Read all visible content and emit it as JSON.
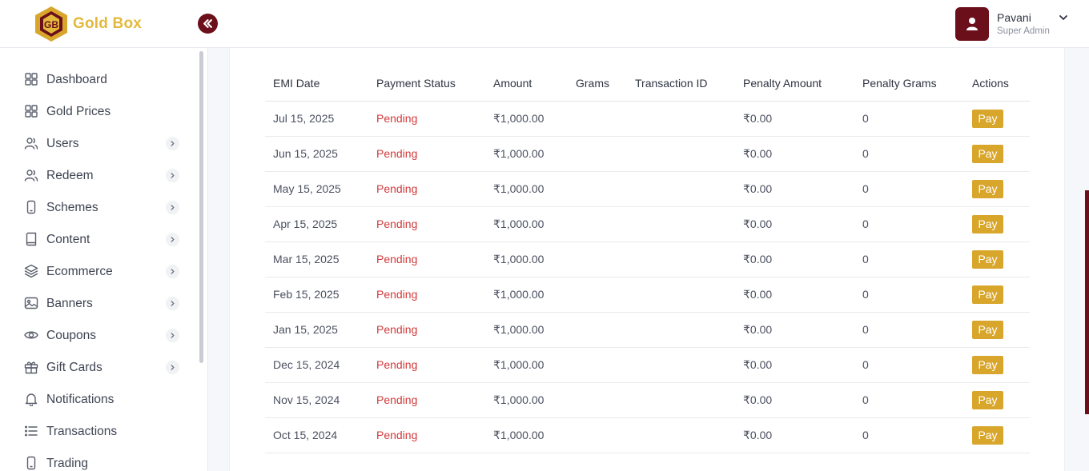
{
  "header": {
    "brand": "Gold Box",
    "user_name": "Pavani",
    "user_role": "Super Admin"
  },
  "colors": {
    "primary": "#6b0f1a",
    "accent_gold": "#d9a62c",
    "brand_text": "#e2b93b",
    "pending": "#d23a3a"
  },
  "sidebar": {
    "items": [
      {
        "label": "Dashboard",
        "icon": "grid-icon",
        "has_submenu": false
      },
      {
        "label": "Gold Prices",
        "icon": "grid-icon",
        "has_submenu": false
      },
      {
        "label": "Users",
        "icon": "users-icon",
        "has_submenu": true
      },
      {
        "label": "Redeem",
        "icon": "users-icon",
        "has_submenu": true
      },
      {
        "label": "Schemes",
        "icon": "mobile-icon",
        "has_submenu": true
      },
      {
        "label": "Content",
        "icon": "book-icon",
        "has_submenu": true
      },
      {
        "label": "Ecommerce",
        "icon": "layers-icon",
        "has_submenu": true
      },
      {
        "label": "Banners",
        "icon": "image-icon",
        "has_submenu": true
      },
      {
        "label": "Coupons",
        "icon": "eye-icon",
        "has_submenu": true
      },
      {
        "label": "Gift Cards",
        "icon": "gift-icon",
        "has_submenu": true
      },
      {
        "label": "Notifications",
        "icon": "bell-icon",
        "has_submenu": false
      },
      {
        "label": "Transactions",
        "icon": "list-icon",
        "has_submenu": false
      },
      {
        "label": "Trading",
        "icon": "mobile-icon",
        "has_submenu": false
      }
    ]
  },
  "table": {
    "headers": [
      "EMI Date",
      "Payment Status",
      "Amount",
      "Grams",
      "Transaction ID",
      "Penalty Amount",
      "Penalty Grams",
      "Actions"
    ],
    "action_label": "Pay",
    "rows": [
      {
        "date": "Jul 15, 2025",
        "status": "Pending",
        "amount": "₹1,000.00",
        "grams": "",
        "txn": "",
        "penalty_amount": "₹0.00",
        "penalty_grams": "0"
      },
      {
        "date": "Jun 15, 2025",
        "status": "Pending",
        "amount": "₹1,000.00",
        "grams": "",
        "txn": "",
        "penalty_amount": "₹0.00",
        "penalty_grams": "0"
      },
      {
        "date": "May 15, 2025",
        "status": "Pending",
        "amount": "₹1,000.00",
        "grams": "",
        "txn": "",
        "penalty_amount": "₹0.00",
        "penalty_grams": "0"
      },
      {
        "date": "Apr 15, 2025",
        "status": "Pending",
        "amount": "₹1,000.00",
        "grams": "",
        "txn": "",
        "penalty_amount": "₹0.00",
        "penalty_grams": "0"
      },
      {
        "date": "Mar 15, 2025",
        "status": "Pending",
        "amount": "₹1,000.00",
        "grams": "",
        "txn": "",
        "penalty_amount": "₹0.00",
        "penalty_grams": "0"
      },
      {
        "date": "Feb 15, 2025",
        "status": "Pending",
        "amount": "₹1,000.00",
        "grams": "",
        "txn": "",
        "penalty_amount": "₹0.00",
        "penalty_grams": "0"
      },
      {
        "date": "Jan 15, 2025",
        "status": "Pending",
        "amount": "₹1,000.00",
        "grams": "",
        "txn": "",
        "penalty_amount": "₹0.00",
        "penalty_grams": "0"
      },
      {
        "date": "Dec 15, 2024",
        "status": "Pending",
        "amount": "₹1,000.00",
        "grams": "",
        "txn": "",
        "penalty_amount": "₹0.00",
        "penalty_grams": "0"
      },
      {
        "date": "Nov 15, 2024",
        "status": "Pending",
        "amount": "₹1,000.00",
        "grams": "",
        "txn": "",
        "penalty_amount": "₹0.00",
        "penalty_grams": "0"
      },
      {
        "date": "Oct 15, 2024",
        "status": "Pending",
        "amount": "₹1,000.00",
        "grams": "",
        "txn": "",
        "penalty_amount": "₹0.00",
        "penalty_grams": "0"
      }
    ]
  }
}
